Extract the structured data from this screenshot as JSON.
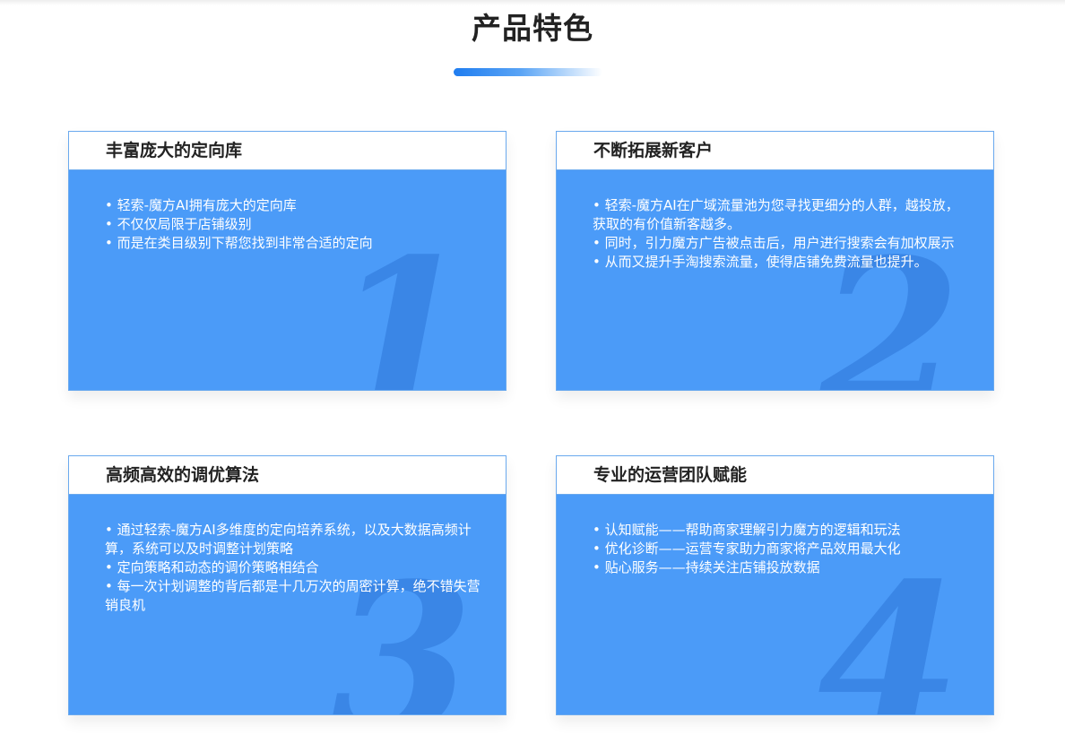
{
  "section": {
    "title": "产品特色"
  },
  "cards": [
    {
      "title": "丰富庞大的定向库",
      "number": "1",
      "items": [
        "• 轻索-魔方AI拥有庞大的定向库",
        "• 不仅仅局限于店铺级别",
        "• 而是在类目级别下帮您找到非常合适的定向"
      ]
    },
    {
      "title": "不断拓展新客户",
      "number": "2",
      "items": [
        "• 轻索-魔方AI在广域流量池为您寻找更细分的人群，越投放，获取的有价值新客越多。",
        "• 同时，引力魔方广告被点击后，用户进行搜索会有加权展示",
        "• 从而又提升手淘搜索流量，使得店铺免费流量也提升。"
      ]
    },
    {
      "title": "高频高效的调优算法",
      "number": "3",
      "items": [
        "• 通过轻索-魔方AI多维度的定向培养系统，以及大数据高频计算，系统可以及时调整计划策略",
        "• 定向策略和动态的调价策略相结合",
        "• 每一次计划调整的背后都是十几万次的周密计算，绝不错失营销良机"
      ]
    },
    {
      "title": "专业的运营团队赋能",
      "number": "4",
      "items": [
        "• 认知赋能——帮助商家理解引力魔方的逻辑和玩法",
        "• 优化诊断——运营专家助力商家将产品效用最大化",
        "• 贴心服务——持续关注店铺投放数据"
      ]
    }
  ],
  "colors": {
    "card_background": "#4b9bf8",
    "card_number": "#3a86e6",
    "accent": "#1f7df0",
    "title_text": "#222222"
  }
}
